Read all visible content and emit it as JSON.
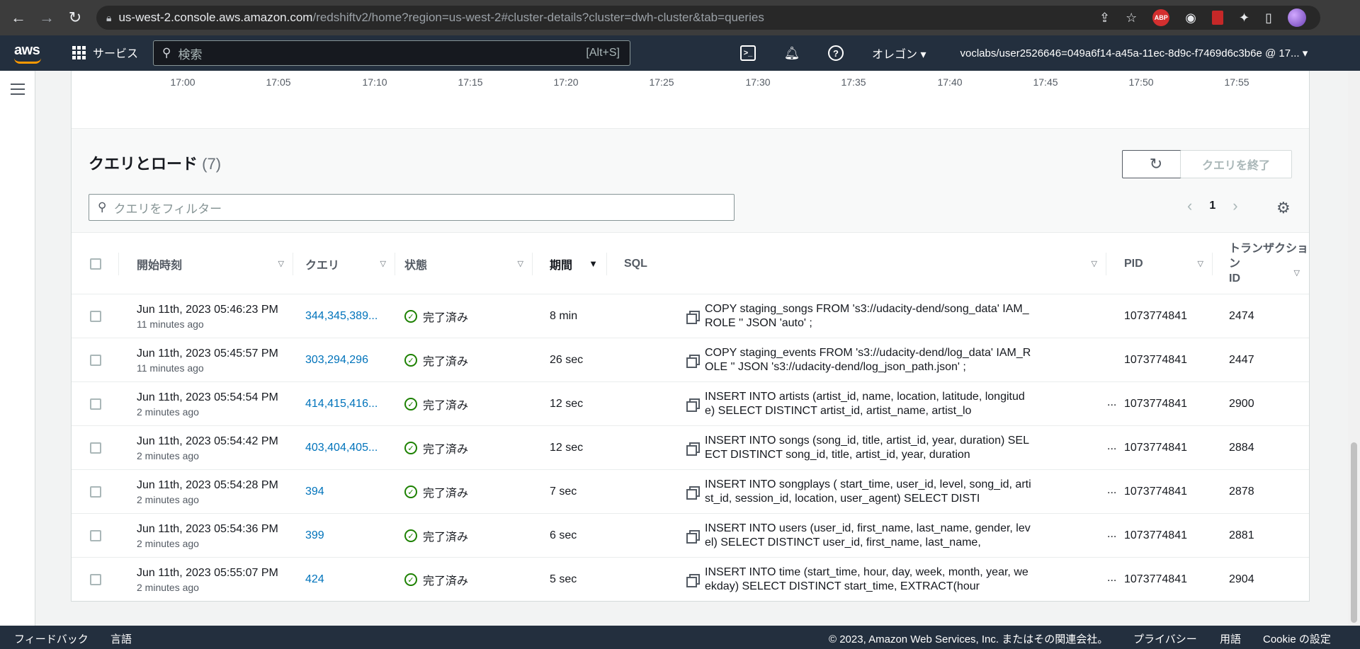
{
  "browser": {
    "url_host": "us-west-2.console.aws.amazon.com",
    "url_path": "/redshiftv2/home?region=us-west-2#cluster-details?cluster=dwh-cluster&tab=queries",
    "abp_label": "ABP"
  },
  "aws_nav": {
    "logo": "aws",
    "services": "サービス",
    "search_placeholder": "検索",
    "search_shortcut": "[Alt+S]",
    "region": "オレゴン ▾",
    "user": "voclabs/user2526646=049a6f14-a45a-11ec-8d9c-f7469d6c3b6e @ 17... ▾"
  },
  "chart_axis": {
    "ticks": [
      "17:00",
      "17:05",
      "17:10",
      "17:15",
      "17:20",
      "17:25",
      "17:30",
      "17:35",
      "17:40",
      "17:45",
      "17:50",
      "17:55"
    ]
  },
  "panel": {
    "title": "クエリとロード",
    "count": "(7)",
    "end_button": "クエリを終了",
    "filter_placeholder": "クエリをフィルター",
    "page": "1"
  },
  "columns": {
    "start_time": "開始時刻",
    "query": "クエリ",
    "status": "状態",
    "duration": "期間",
    "sql": "SQL",
    "pid": "PID",
    "txn_line1": "トランザクション",
    "txn_line2": "ID"
  },
  "rows": [
    {
      "time": "Jun 11th, 2023 05:46:23 PM",
      "ago": "11 minutes ago",
      "query": "344,345,389...",
      "status": "完了済み",
      "duration": "8 min",
      "sql": "COPY staging_songs FROM 's3://udacity-dend/song_data' IAM_ROLE '' JSON 'auto' ;",
      "ellipsis": "",
      "pid": "1073774841",
      "txn": "2474"
    },
    {
      "time": "Jun 11th, 2023 05:45:57 PM",
      "ago": "11 minutes ago",
      "query": "303,294,296",
      "status": "完了済み",
      "duration": "26 sec",
      "sql": "COPY staging_events FROM 's3://udacity-dend/log_data' IAM_ROLE '' JSON 's3://udacity-dend/log_json_path.json' ;",
      "ellipsis": "",
      "pid": "1073774841",
      "txn": "2447"
    },
    {
      "time": "Jun 11th, 2023 05:54:54 PM",
      "ago": "2 minutes ago",
      "query": "414,415,416...",
      "status": "完了済み",
      "duration": "12 sec",
      "sql": "INSERT INTO artists (artist_id, name, location, latitude, longitude) SELECT DISTINCT artist_id, artist_name, artist_lo",
      "ellipsis": "...",
      "pid": "1073774841",
      "txn": "2900"
    },
    {
      "time": "Jun 11th, 2023 05:54:42 PM",
      "ago": "2 minutes ago",
      "query": "403,404,405...",
      "status": "完了済み",
      "duration": "12 sec",
      "sql": "INSERT INTO songs (song_id, title, artist_id, year, duration) SELECT DISTINCT song_id, title, artist_id, year, duration",
      "ellipsis": "...",
      "pid": "1073774841",
      "txn": "2884"
    },
    {
      "time": "Jun 11th, 2023 05:54:28 PM",
      "ago": "2 minutes ago",
      "query": "394",
      "status": "完了済み",
      "duration": "7 sec",
      "sql": "INSERT INTO songplays ( start_time, user_id, level, song_id, artist_id, session_id, location, user_agent) SELECT DISTI",
      "ellipsis": "...",
      "pid": "1073774841",
      "txn": "2878"
    },
    {
      "time": "Jun 11th, 2023 05:54:36 PM",
      "ago": "2 minutes ago",
      "query": "399",
      "status": "完了済み",
      "duration": "6 sec",
      "sql": "INSERT INTO users (user_id, first_name, last_name, gender, level) SELECT DISTINCT user_id, first_name, last_name,",
      "ellipsis": "...",
      "pid": "1073774841",
      "txn": "2881"
    },
    {
      "time": "Jun 11th, 2023 05:55:07 PM",
      "ago": "2 minutes ago",
      "query": "424",
      "status": "完了済み",
      "duration": "5 sec",
      "sql": "INSERT INTO time (start_time, hour, day, week, month, year, weekday) SELECT DISTINCT start_time, EXTRACT(hour",
      "ellipsis": "...",
      "pid": "1073774841",
      "txn": "2904"
    }
  ],
  "footer": {
    "feedback": "フィードバック",
    "language": "言語",
    "copyright": "© 2023, Amazon Web Services, Inc. またはその関連会社。",
    "privacy": "プライバシー",
    "terms": "用語",
    "cookie": "Cookie の設定"
  },
  "colors": {
    "aws_nav_bg": "#232f3e",
    "link": "#0073bb",
    "success": "#1d8102",
    "aws_orange": "#ff9900"
  }
}
